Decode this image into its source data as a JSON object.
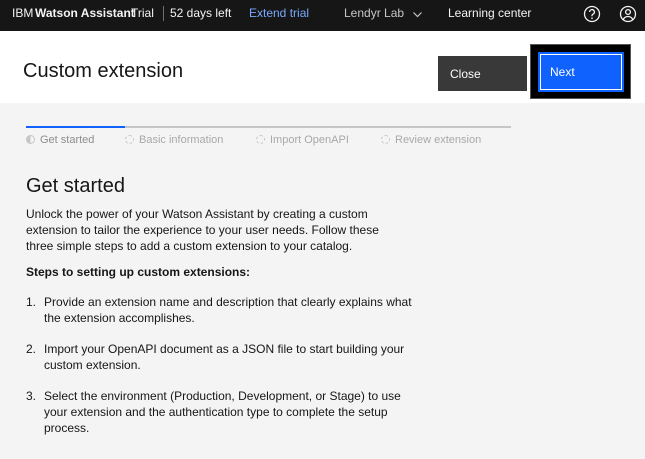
{
  "header": {
    "brand_ibm": "IBM",
    "brand_product": "Watson Assistant",
    "brand_trial": "Trial",
    "days_left": "52 days left",
    "extend_trial": "Extend trial",
    "workspace": "Lendyr Lab",
    "learning_center": "Learning center"
  },
  "titlebar": {
    "title": "Custom extension",
    "close_label": "Close",
    "next_label": "Next"
  },
  "progress": {
    "steps": [
      {
        "label": "Get started"
      },
      {
        "label": "Basic information"
      },
      {
        "label": "Import OpenAPI"
      },
      {
        "label": "Review extension"
      }
    ]
  },
  "main": {
    "section_title": "Get started",
    "intro": "Unlock the power of your Watson Assistant by creating a custom extension to tailor the experience to your user needs. Follow these three simple steps to add a custom extension to your catalog.",
    "steps_heading": "Steps to setting up custom extensions:",
    "steps": [
      {
        "num": "1.",
        "text": "Provide an extension name and description that clearly explains what the extension accomplishes."
      },
      {
        "num": "2.",
        "text": "Import your OpenAPI document as a JSON file to start building your custom extension."
      },
      {
        "num": "3.",
        "text": "Select the environment (Production, Development, or Stage) to use your extension and the authentication type to complete the setup process."
      }
    ]
  },
  "colors": {
    "header_bg": "#161616",
    "link_blue": "#78a9ff",
    "primary_button": "#0f62fe",
    "secondary_button": "#393939",
    "page_bg": "#f4f4f4"
  }
}
